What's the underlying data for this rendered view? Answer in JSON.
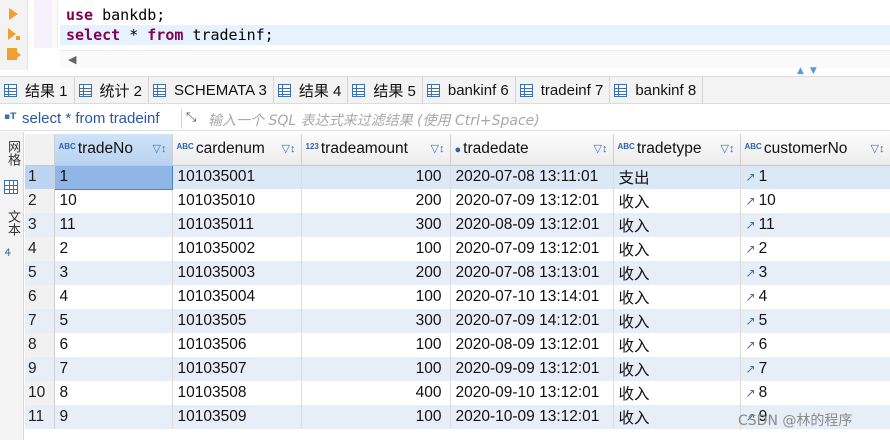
{
  "editor": {
    "line1": {
      "keyword": "use",
      "rest": " bankdb;"
    },
    "line2": {
      "keyword": "select",
      "mid": " * ",
      "keyword2": "from",
      "rest": " tradeinf;"
    }
  },
  "tabs": [
    "结果 1",
    "统计 2",
    "SCHEMATA 3",
    "结果 4",
    "结果 5",
    "bankinf 6",
    "tradeinf 7",
    "bankinf 8"
  ],
  "filter": {
    "query": "select * from tradeinf",
    "placeholder": "输入一个 SQL 表达式来过滤结果 (使用 Ctrl+Space)"
  },
  "side_panel": {
    "grid_label": "网格",
    "text_label": "文本"
  },
  "columns": [
    {
      "type": "ABC",
      "name": "tradeNo"
    },
    {
      "type": "ABC",
      "name": "cardenum"
    },
    {
      "type": "123",
      "name": "tradeamount"
    },
    {
      "type": "clock",
      "name": "tradedate"
    },
    {
      "type": "ABC",
      "name": "tradetype"
    },
    {
      "type": "ABC",
      "name": "customerNo"
    }
  ],
  "rows": [
    {
      "n": "1",
      "tradeNo": "1",
      "cardenum": "101035001",
      "tradeamount": "100",
      "tradedate": "2020-07-08 13:11:01",
      "tradetype": "支出",
      "customerNo": "1"
    },
    {
      "n": "2",
      "tradeNo": "10",
      "cardenum": "101035010",
      "tradeamount": "200",
      "tradedate": "2020-07-09 13:12:01",
      "tradetype": "收入",
      "customerNo": "10"
    },
    {
      "n": "3",
      "tradeNo": "11",
      "cardenum": "101035011",
      "tradeamount": "300",
      "tradedate": "2020-08-09 13:12:01",
      "tradetype": "收入",
      "customerNo": "11"
    },
    {
      "n": "4",
      "tradeNo": "2",
      "cardenum": "101035002",
      "tradeamount": "100",
      "tradedate": "2020-07-09 13:12:01",
      "tradetype": "收入",
      "customerNo": "2"
    },
    {
      "n": "5",
      "tradeNo": "3",
      "cardenum": "101035003",
      "tradeamount": "200",
      "tradedate": "2020-07-08 13:13:01",
      "tradetype": "收入",
      "customerNo": "3"
    },
    {
      "n": "6",
      "tradeNo": "4",
      "cardenum": "101035004",
      "tradeamount": "100",
      "tradedate": "2020-07-10 13:14:01",
      "tradetype": "收入",
      "customerNo": "4"
    },
    {
      "n": "7",
      "tradeNo": "5",
      "cardenum": "10103505",
      "tradeamount": "300",
      "tradedate": "2020-07-09 14:12:01",
      "tradetype": "收入",
      "customerNo": "5"
    },
    {
      "n": "8",
      "tradeNo": "6",
      "cardenum": "10103506",
      "tradeamount": "100",
      "tradedate": "2020-08-09 13:12:01",
      "tradetype": "收入",
      "customerNo": "6"
    },
    {
      "n": "9",
      "tradeNo": "7",
      "cardenum": "10103507",
      "tradeamount": "100",
      "tradedate": "2020-09-09 13:12:01",
      "tradetype": "收入",
      "customerNo": "7"
    },
    {
      "n": "10",
      "tradeNo": "8",
      "cardenum": "10103508",
      "tradeamount": "400",
      "tradedate": "2020-09-10 13:12:01",
      "tradetype": "收入",
      "customerNo": "8"
    },
    {
      "n": "11",
      "tradeNo": "9",
      "cardenum": "10103509",
      "tradeamount": "100",
      "tradedate": "2020-10-09 13:12:01",
      "tradetype": "收入",
      "customerNo": "9"
    }
  ],
  "watermark": "CSDN @林的程序",
  "colors": {
    "keyword": "#7f0055",
    "accent": "#3b6fb6",
    "alt_row": "#e7eef8",
    "selected_cell": "#8fb6e6",
    "query_text": "#2a57a8"
  }
}
